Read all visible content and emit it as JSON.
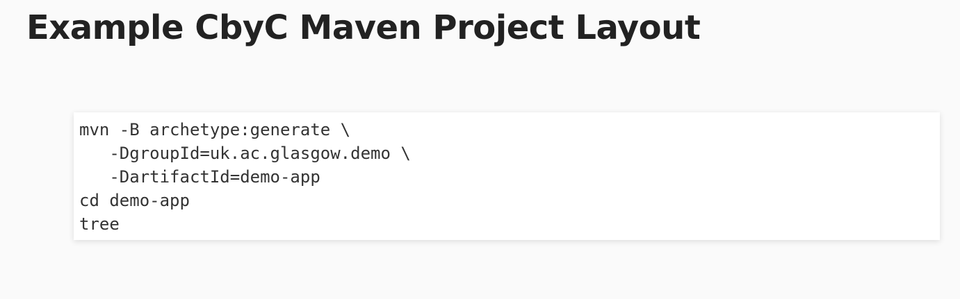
{
  "slide": {
    "title": "Example CbyC Maven Project Layout"
  },
  "code": {
    "lines": [
      "mvn -B archetype:generate \\",
      "   -DgroupId=uk.ac.glasgow.demo \\",
      "   -DartifactId=demo-app",
      "cd demo-app",
      "tree"
    ]
  }
}
